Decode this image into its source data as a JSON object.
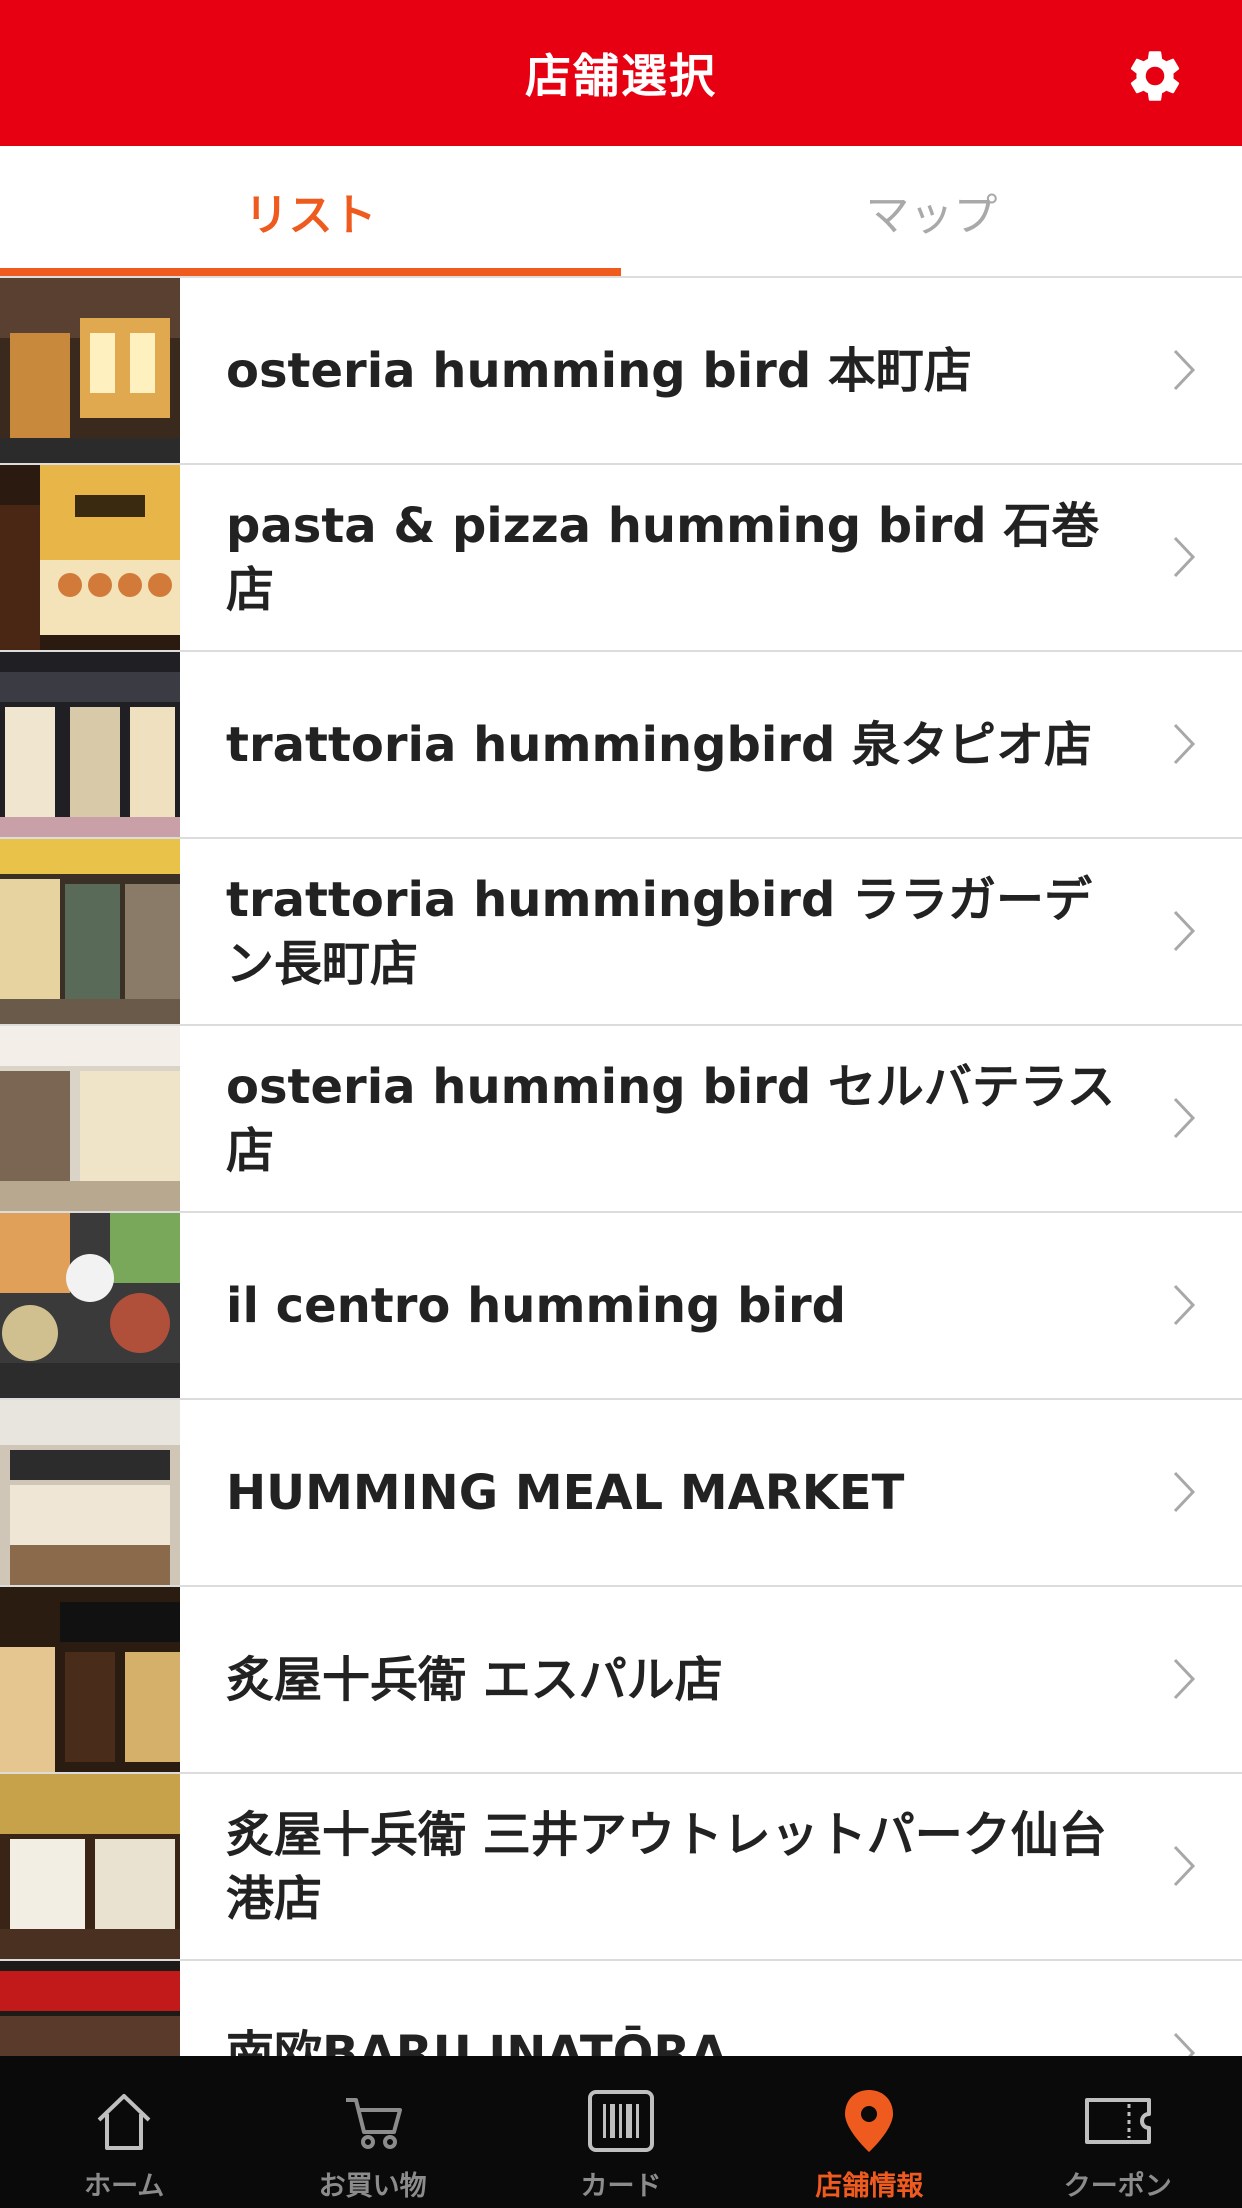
{
  "header": {
    "title": "店舗選択",
    "settings_icon": "gear-icon",
    "background": "#e60012"
  },
  "tabs": [
    {
      "label": "リスト",
      "active": true
    },
    {
      "label": "マップ",
      "active": false
    }
  ],
  "accent": "#ef5a1f",
  "stores": [
    {
      "name": "osteria humming bird 本町店"
    },
    {
      "name": "pasta & pizza humming bird 石巻店"
    },
    {
      "name": "trattoria hummingbird 泉タピオ店"
    },
    {
      "name": "trattoria hummingbird ララガーデン長町店"
    },
    {
      "name": "osteria humming bird セルバテラス店"
    },
    {
      "name": "il centro humming bird"
    },
    {
      "name": "HUMMING MEAL MARKET"
    },
    {
      "name": "炙屋十兵衛 エスパル店"
    },
    {
      "name": "炙屋十兵衛 三井アウトレットパーク仙台港店"
    },
    {
      "name": "南欧BARU INATŌRA"
    }
  ],
  "bottom_nav": [
    {
      "label": "ホーム",
      "icon": "home-icon",
      "active": false
    },
    {
      "label": "お買い物",
      "icon": "cart-icon",
      "active": false
    },
    {
      "label": "カード",
      "icon": "barcode-card-icon",
      "active": false
    },
    {
      "label": "店舗情報",
      "icon": "map-pin-icon",
      "active": true
    },
    {
      "label": "クーポン",
      "icon": "ticket-icon",
      "active": false
    }
  ]
}
